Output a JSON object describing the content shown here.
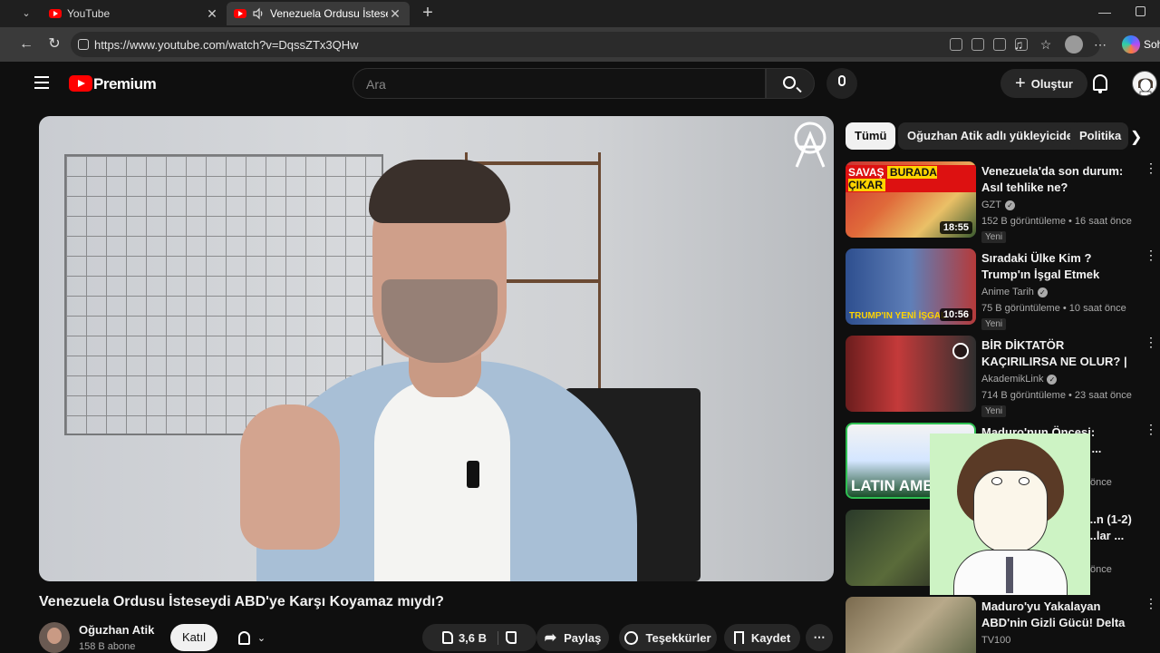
{
  "browser": {
    "tabs": [
      {
        "title": "YouTube"
      },
      {
        "title": "Venezuela Ordusu İsteseydi A"
      }
    ],
    "url": "https://www.youtube.com/watch?v=DqssZTx3QHw",
    "copilot_label": "Soh"
  },
  "header": {
    "logo_text": "Premium",
    "search_placeholder": "Ara",
    "create_label": "Oluştur"
  },
  "video": {
    "title": "Venezuela Ordusu İsteseydi ABD'ye Karşı Koyamaz mıydı?",
    "channel": "Oğuzhan Atik",
    "subscribers": "158 B abone",
    "join_label": "Katıl",
    "likes": "3,6 B",
    "share_label": "Paylaş",
    "thanks_label": "Teşekkürler",
    "save_label": "Kaydet"
  },
  "chips": [
    {
      "label": "Tümü",
      "active": true
    },
    {
      "label": "Oğuzhan Atik adlı yükleyiciden",
      "active": false
    },
    {
      "label": "Politika",
      "active": false
    }
  ],
  "recommendations": [
    {
      "title": "Venezuela'da son durum: Asıl tehlike ne?",
      "channel": "GZT",
      "meta": "152 B görüntüleme • 16 saat önce",
      "badge": "Yeni",
      "duration": "18:55",
      "thumb_text_1": "SAVAŞ",
      "thumb_text_2": "BURADA ÇIKAR"
    },
    {
      "title": "Sıradaki Ülke Kim ? Trump'ın İşgal Etmek İstediği Ülkeler",
      "channel": "Anime Tarih",
      "meta": "75 B görüntüleme • 10 saat önce",
      "badge": "Yeni",
      "duration": "10:56",
      "thumb_text": "TRUMP'IN YENİ İŞGAL"
    },
    {
      "title": "BİR DİKTATÖR KAÇIRILIRSA NE OLUR? | Venezuela Devlet ...",
      "channel": "AkademikLink",
      "meta": "714 B görüntüleme • 23 saat önce",
      "badge": "Yeni"
    },
    {
      "title": "Maduro'nun Öncesi: Panama'nın ...onu / ...",
      "meta": "önce",
      "thumb_text": "LATIN AME"
    },
    {
      "title": "...n (1-2) ...lar ...",
      "meta": "önce"
    },
    {
      "title": "Maduro'yu Yakalayan ABD'nin Gizli Gücü! Delta Force Nedir? ...",
      "channel": "TV100"
    }
  ]
}
